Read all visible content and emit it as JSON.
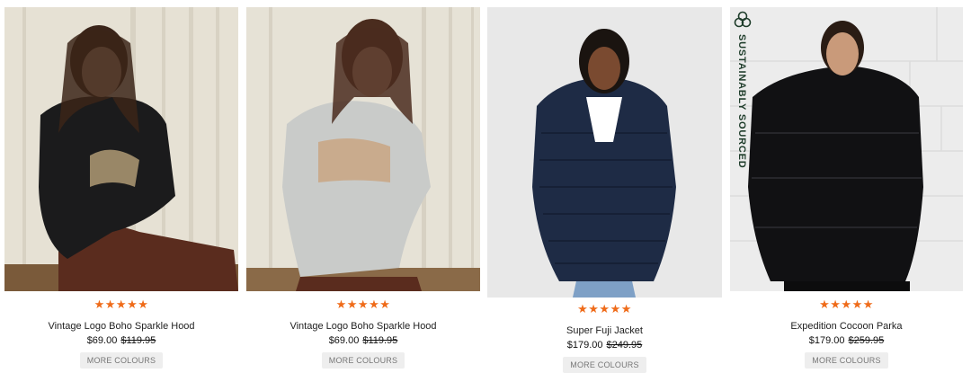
{
  "products": [
    {
      "rating": "★★★★★",
      "name": "Vintage Logo Boho Sparkle Hood",
      "price": "$69.00",
      "old_price": "$119.95",
      "button": "MORE COLOURS"
    },
    {
      "rating": "★★★★★",
      "name": "Vintage Logo Boho Sparkle Hood",
      "price": "$69.00",
      "old_price": "$119.95",
      "button": "MORE COLOURS"
    },
    {
      "rating": "★★★★★",
      "name": "Super Fuji Jacket",
      "price": "$179.00",
      "old_price": "$249.95",
      "button": "MORE COLOURS"
    },
    {
      "rating": "★★★★★",
      "name": "Expedition Cocoon Parka",
      "price": "$179.00",
      "old_price": "$259.95",
      "button": "MORE COLOURS",
      "badge": "SUSTAINABLY SOURCED"
    }
  ],
  "colors": {
    "star": "#ef6b19",
    "badge_text": "#1f3d2b",
    "button_bg": "#eeeeee"
  }
}
